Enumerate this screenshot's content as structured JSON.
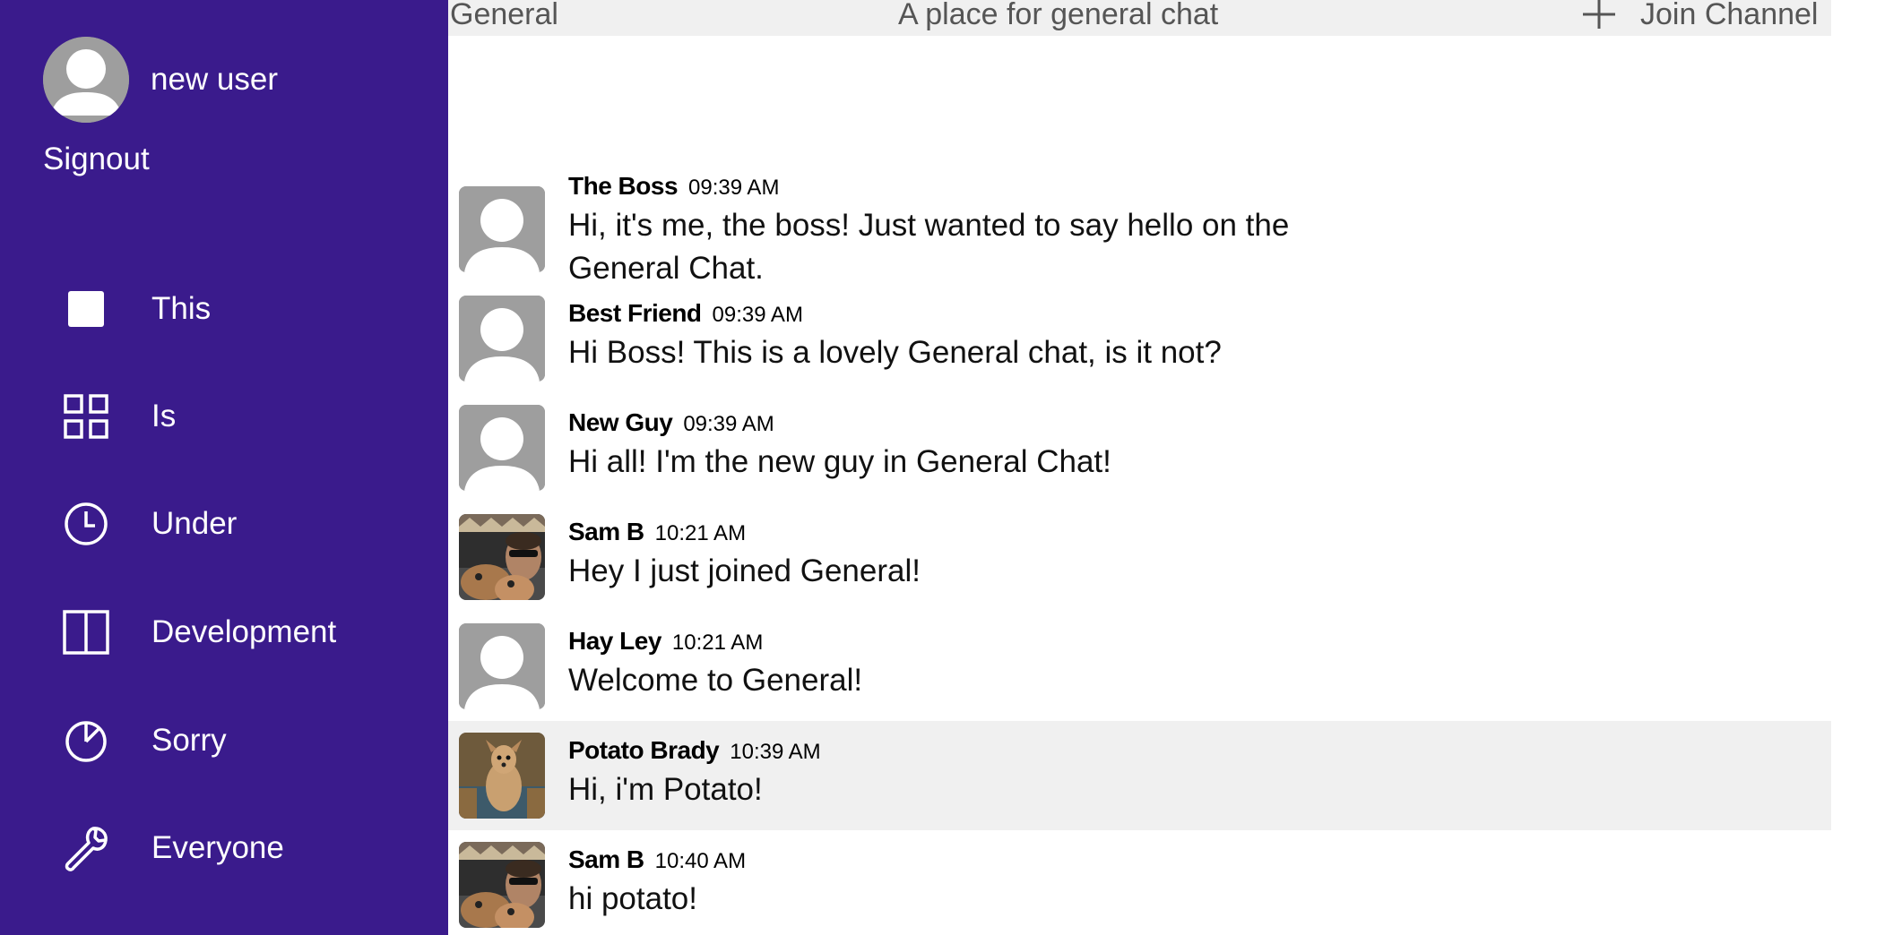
{
  "sidebar": {
    "user_name": "new user",
    "signout_label": "Signout",
    "items": [
      {
        "label": "This",
        "icon": "square-icon"
      },
      {
        "label": "Is",
        "icon": "grid-icon"
      },
      {
        "label": "Under",
        "icon": "clock-icon"
      },
      {
        "label": "Development",
        "icon": "book-icon"
      },
      {
        "label": "Sorry",
        "icon": "pie-chart-icon"
      },
      {
        "label": "Everyone",
        "icon": "wrench-icon"
      }
    ],
    "background_color": "#3a1b8c"
  },
  "header": {
    "channel_name": "General",
    "channel_description": "A place for general chat",
    "join_label": "Join Channel",
    "join_icon": "plus-icon"
  },
  "messages": [
    {
      "author": "The Boss",
      "time": "09:39 AM",
      "text": "Hi, it's me, the boss! Just wanted to say hello on the General Chat.",
      "avatar": "default-avatar"
    },
    {
      "author": "Best Friend",
      "time": "09:39 AM",
      "text": "Hi Boss! This is a lovely General chat, is it not?",
      "avatar": "default-avatar"
    },
    {
      "author": "New Guy",
      "time": "09:39 AM",
      "text": "Hi all! I'm the new guy in General Chat!",
      "avatar": "default-avatar"
    },
    {
      "author": "Sam B",
      "time": "10:21 AM",
      "text": "Hey I just joined General!",
      "avatar": "photo-avatar"
    },
    {
      "author": "Hay Ley",
      "time": "10:21 AM",
      "text": "Welcome to General!",
      "avatar": "default-avatar"
    },
    {
      "author": "Potato Brady",
      "time": "10:39 AM",
      "text": "Hi, i'm Potato!",
      "avatar": "dog-photo-avatar"
    },
    {
      "author": "Sam B",
      "time": "10:40 AM",
      "text": "hi potato!",
      "avatar": "photo-avatar"
    }
  ]
}
